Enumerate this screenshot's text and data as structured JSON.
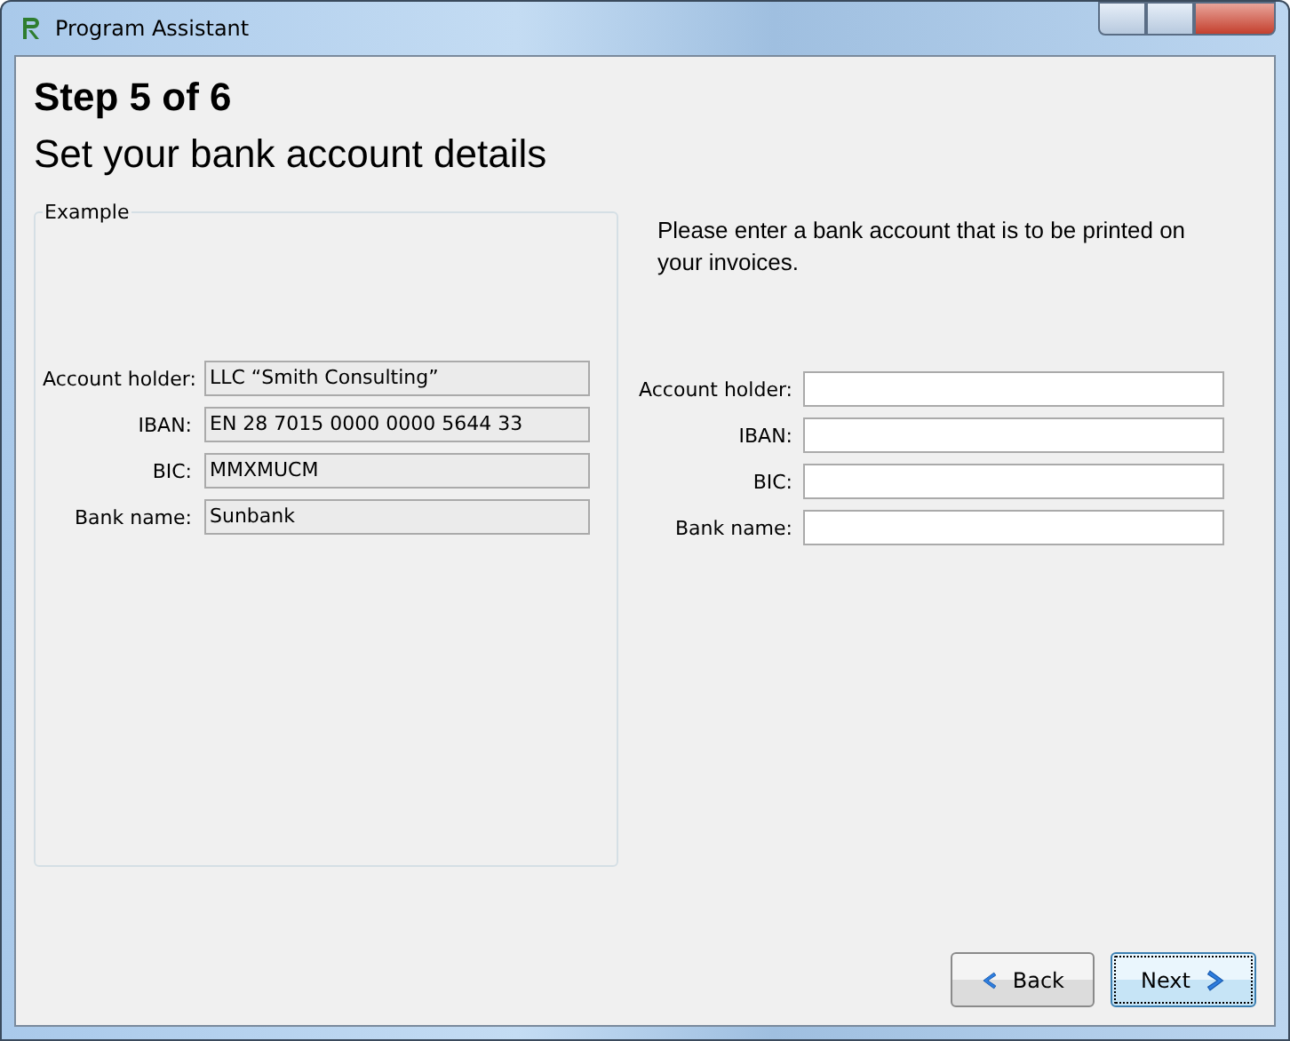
{
  "window": {
    "title": "Program Assistant"
  },
  "step": "Step 5 of 6",
  "heading": "Set your bank account details",
  "example": {
    "legend": "Example",
    "fields": [
      {
        "label": "Account holder:",
        "value": "LLC “Smith Consulting”"
      },
      {
        "label": "IBAN:",
        "value": "EN 28 7015 0000 0000 5644 33"
      },
      {
        "label": "BIC:",
        "value": "MMXMUCM"
      },
      {
        "label": "Bank name:",
        "value": "Sunbank"
      }
    ]
  },
  "instructions": "Please enter a bank account that is to be printed on your invoices.",
  "form": {
    "fields": [
      {
        "label": "Account holder:"
      },
      {
        "label": "IBAN:"
      },
      {
        "label": "BIC:"
      },
      {
        "label": "Bank name:"
      }
    ]
  },
  "buttons": [
    {
      "label": "Back",
      "kind": "back",
      "focused": false
    },
    {
      "label": "Next",
      "kind": "next",
      "focused": true
    }
  ]
}
